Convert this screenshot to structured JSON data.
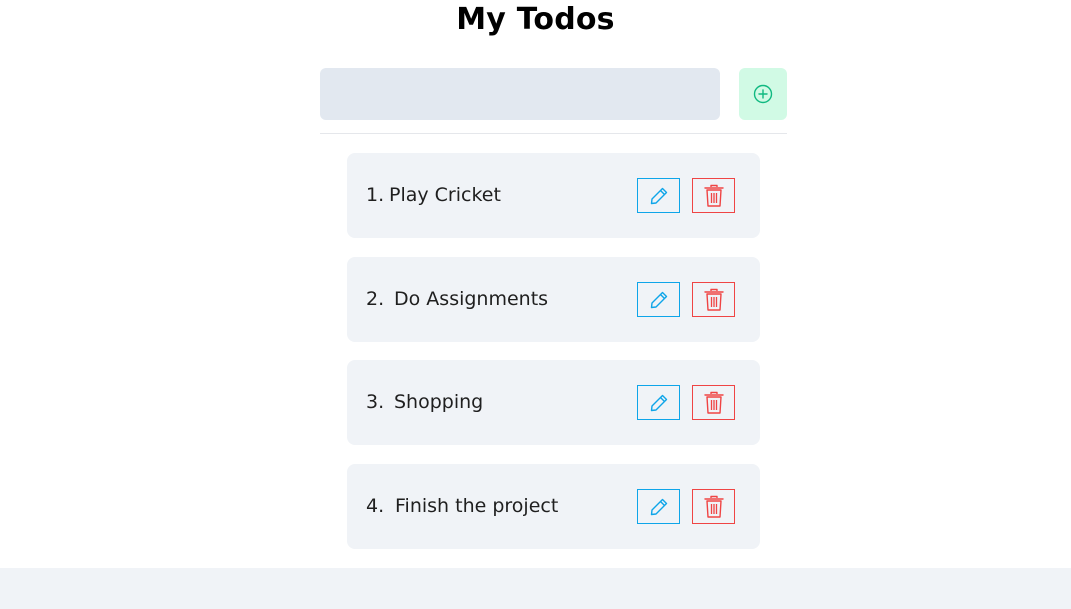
{
  "app": {
    "title": "My Todos"
  },
  "new_todo": {
    "value": "",
    "placeholder": "",
    "add_icon": "plus-circle-icon"
  },
  "todos": [
    {
      "number": "1.",
      "text": "Play Cricket"
    },
    {
      "number": "2.",
      "text": "Do Assignments"
    },
    {
      "number": "3.",
      "text": "Shopping"
    },
    {
      "number": "4.",
      "text": "Finish the project"
    }
  ],
  "icons": {
    "edit": "pencil-icon",
    "delete": "trash-icon"
  },
  "colors": {
    "add_accent": "#10b981",
    "add_background": "#d1fae5",
    "edit_accent": "#0ea5e9",
    "delete_accent": "#ef4444",
    "card_background": "#f0f3f7",
    "input_background": "#e2e8f0"
  }
}
